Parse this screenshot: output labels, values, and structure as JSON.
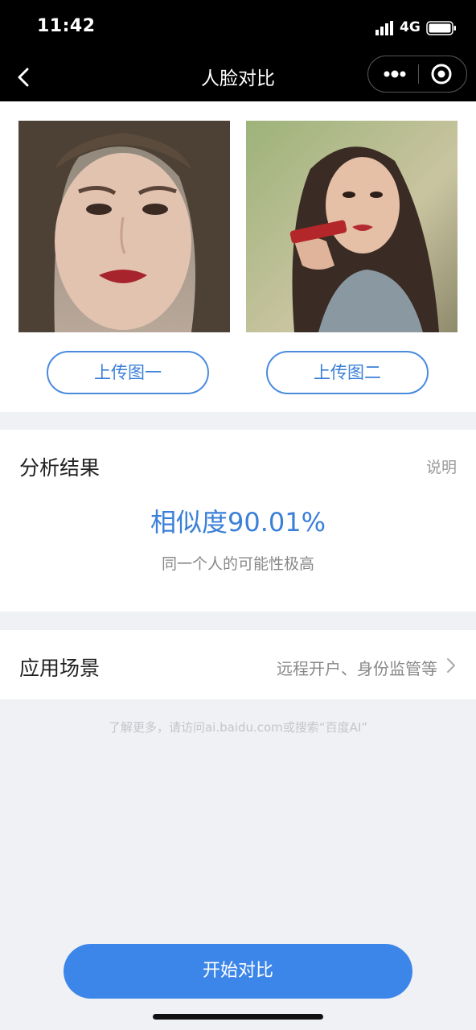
{
  "status_bar": {
    "time": "11:42",
    "network": "4G",
    "signal_icon": "signal-icon",
    "battery_icon": "battery-icon"
  },
  "nav": {
    "title": "人脸对比",
    "back_icon": "chevron-left-icon",
    "more_icon": "more-dots-icon",
    "close_icon": "target-circle-icon"
  },
  "photos": {
    "upload_1_label": "上传图一",
    "upload_2_label": "上传图二"
  },
  "result": {
    "title": "分析结果",
    "explain_label": "说明",
    "similarity_text": "相似度90.01%",
    "similarity_value": 90.01,
    "verdict": "同一个人的可能性极高"
  },
  "scene": {
    "title": "应用场景",
    "value": "远程开户、身份监管等",
    "chevron_icon": "chevron-right-icon"
  },
  "footnote": "了解更多，请访问ai.baidu.com或搜索“百度AI”",
  "start_button_label": "开始对比",
  "colors": {
    "accent": "#3d86e9",
    "nav_bg": "#000000",
    "page_bg": "#f0f1f4"
  }
}
